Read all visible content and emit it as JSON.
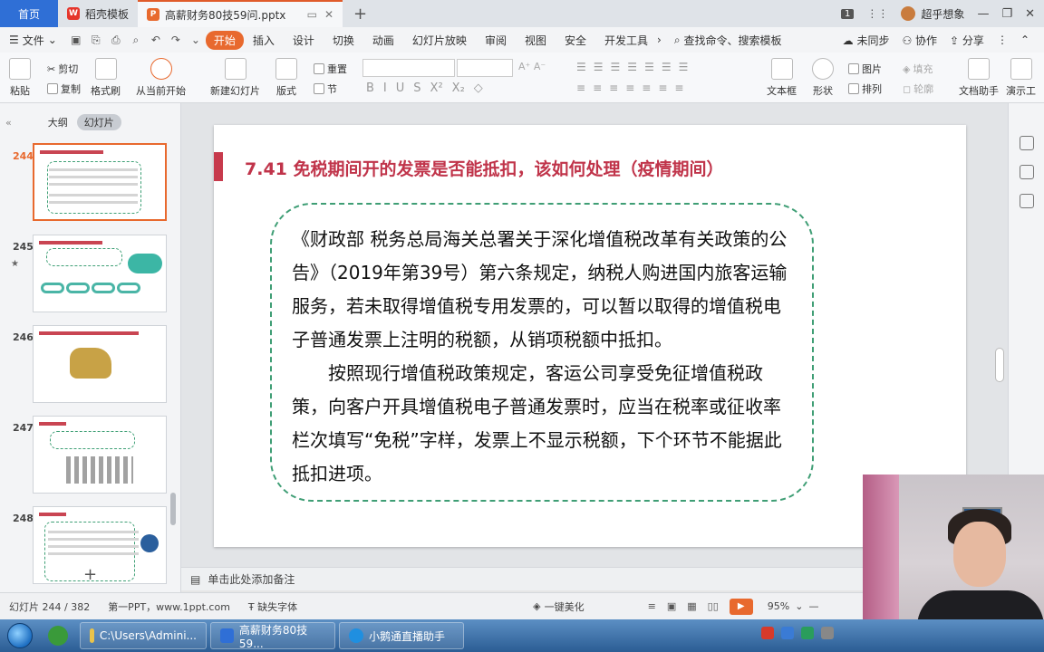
{
  "titlebar": {
    "home_tab": "首页",
    "template_tab": "稻壳模板",
    "doc_tab": "高薪财务80技59问.pptx",
    "window_count": "1",
    "user_name": "超乎想象"
  },
  "menubar": {
    "file": "文件",
    "items": [
      "开始",
      "插入",
      "设计",
      "切换",
      "动画",
      "幻灯片放映",
      "审阅",
      "视图",
      "安全",
      "开发工具"
    ],
    "search": "查找命令、搜索模板",
    "sync": "未同步",
    "collab": "协作",
    "share": "分享"
  },
  "ribbon": {
    "paste": "粘贴",
    "cut": "剪切",
    "copy": "复制",
    "format_painter": "格式刷",
    "from_current": "从当前开始",
    "new_slide": "新建幻灯片",
    "layout": "版式",
    "reset": "重置",
    "section": "节",
    "textbox": "文本框",
    "shape": "形状",
    "picture": "图片",
    "fill": "填充",
    "arrange": "排列",
    "outline": "轮廓",
    "doc_assistant": "文档助手",
    "present_tool": "演示工"
  },
  "leftpanel": {
    "outline_tab": "大纲",
    "slides_tab": "幻灯片",
    "thumbs": [
      {
        "num": "244"
      },
      {
        "num": "245"
      },
      {
        "num": "246"
      },
      {
        "num": "247"
      },
      {
        "num": "248"
      }
    ]
  },
  "slide": {
    "title": "7.41  免税期间开的发票是否能抵扣，该如何处理（疫情期间）",
    "para1": "《财政部  税务总局海关总署关于深化增值税改革有关政策的公告》（2019年第39号）第六条规定，纳税人购进国内旅客运输服务，若未取得增值税专用发票的，可以暂以取得的增值税电子普通发票上注明的税额，从销项税额中抵扣。",
    "para2": "按照现行增值税政策规定，客运公司享受免征增值税政策，向客户开具增值税电子普通发票时，应当在税率或征收率栏次填写“免税”字样，发票上不显示税额，下个环节不能据此抵扣进项。"
  },
  "notes": {
    "placeholder": "单击此处添加备注"
  },
  "status": {
    "slide_pos": "幻灯片 244 / 382",
    "theme": "第一PPT，www.1ppt.com",
    "missing_font": "缺失字体",
    "beautify": "一键美化",
    "zoom": "95%"
  },
  "taskbar": {
    "explorer": "C:\\Users\\Admini...",
    "wps": "高薪财务80技59...",
    "live": "小鹅通直播助手"
  }
}
